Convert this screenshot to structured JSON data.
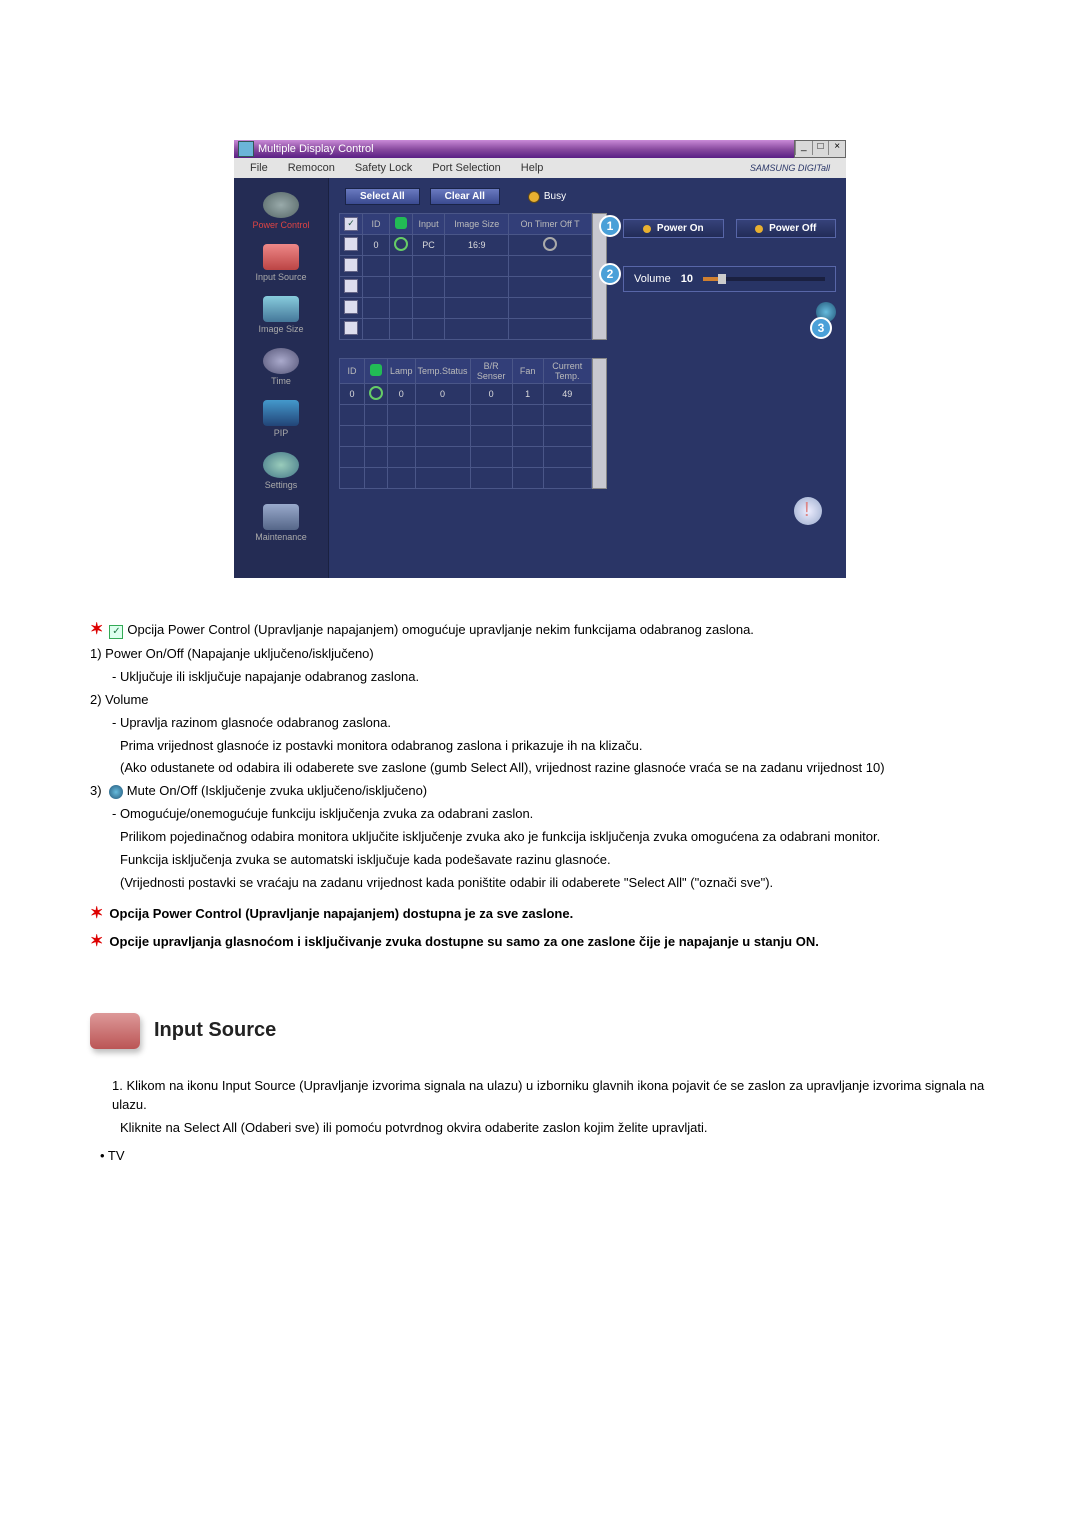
{
  "window": {
    "title": "Multiple Display Control",
    "menu": [
      "File",
      "Remocon",
      "Safety Lock",
      "Port Selection",
      "Help"
    ],
    "brand": "SAMSUNG DIGITall"
  },
  "sidebar": [
    {
      "label": "Power Control",
      "active": true
    },
    {
      "label": "Input Source"
    },
    {
      "label": "Image Size"
    },
    {
      "label": "Time"
    },
    {
      "label": "PIP"
    },
    {
      "label": "Settings"
    },
    {
      "label": "Maintenance"
    }
  ],
  "toolbar": {
    "select_all": "Select All",
    "clear_all": "Clear All",
    "busy": "Busy"
  },
  "table1": {
    "headers": [
      "",
      "ID",
      "",
      "Input",
      "Image Size",
      "On Timer Off T"
    ],
    "row": {
      "id": "0",
      "input": "PC",
      "image_size": "16:9"
    }
  },
  "table2": {
    "headers": [
      "ID",
      "",
      "Lamp",
      "Temp.Status",
      "B/R Senser",
      "Fan",
      "Current Temp."
    ],
    "row": {
      "id": "0",
      "lamp": "0",
      "temp_status": "0",
      "br": "0",
      "fan": "1",
      "ct": "49"
    }
  },
  "right_panel": {
    "power_on": "Power On",
    "power_off": "Power Off",
    "volume_label": "Volume",
    "volume_value": "10"
  },
  "badges": {
    "b1": "1",
    "b2": "2",
    "b3": "3"
  },
  "doc": {
    "intro": "Opcija Power Control (Upravljanje napajanjem) omogućuje upravljanje nekim funkcijama odabranog zaslona.",
    "i1_t": "1)  Power On/Off (Napajanje uključeno/isključeno)",
    "i1_d": "- Uključuje ili isključuje napajanje odabranog zaslona.",
    "i2_t": "2)  Volume",
    "i2_d1": "- Upravlja razinom glasnoće odabranog zaslona.",
    "i2_d2": "Prima vrijednost glasnoće iz postavki monitora odabranog zaslona i prikazuje ih na klizaču.",
    "i2_d3": "(Ako odustanete od odabira ili odaberete sve zaslone (gumb Select All), vrijednost razine glasnoće vraća se na zadanu vrijednost 10)",
    "i3_t": "3)",
    "i3_l": "Mute On/Off (Isključenje zvuka uključeno/isključeno)",
    "i3_d1": "- Omogućuje/onemogućuje funkciju isključenja zvuka za odabrani zaslon.",
    "i3_d2": "Prilikom pojedinačnog odabira monitora uključite isključenje zvuka ako je funkcija isključenja zvuka omogućena za odabrani monitor.",
    "i3_d3": "Funkcija isključenja zvuka se automatski isključuje kada podešavate razinu glasnoće.",
    "i3_d4": "(Vrijednosti postavki se vraćaju na zadanu vrijednost kada poništite odabir ili odaberete \"Select All\" (\"označi sve\").",
    "n1": "Opcija Power Control (Upravljanje napajanjem) dostupna je za sve zaslone.",
    "n2": "Opcije upravljanja glasnoćom i isključivanje zvuka dostupne su samo za one zaslone čije je napajanje u stanju ON.",
    "section": "Input Source",
    "s1_t": "1.  Klikom na ikonu Input Source (Upravljanje izvorima signala na ulazu) u izborniku glavnih ikona pojavit će se zaslon za upravljanje izvorima signala na ulazu.",
    "s1_d": "Kliknite na Select All (Odaberi sve) ili pomoću potvrdnog okvira odaberite zaslon kojim želite upravljati.",
    "s2": "• TV"
  }
}
